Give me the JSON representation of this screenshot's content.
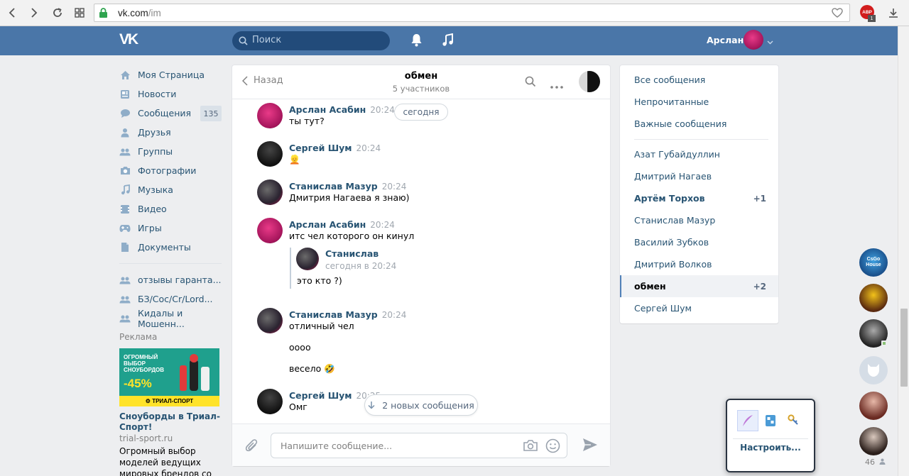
{
  "browser": {
    "url_host": "vk.com",
    "url_path": "/im",
    "abp": "ABP",
    "abp_badge": "1"
  },
  "header": {
    "logo": "VK",
    "search_placeholder": "Поиск",
    "user_name": "Арслан"
  },
  "left_menu": {
    "items": [
      {
        "label": "Моя Страница",
        "icon": "home-icon"
      },
      {
        "label": "Новости",
        "icon": "news-icon"
      },
      {
        "label": "Сообщения",
        "icon": "messages-icon",
        "count": "135"
      },
      {
        "label": "Друзья",
        "icon": "friend-icon"
      },
      {
        "label": "Группы",
        "icon": "groups-icon"
      },
      {
        "label": "Фотографии",
        "icon": "camera-icon"
      },
      {
        "label": "Музыка",
        "icon": "music-icon"
      },
      {
        "label": "Видео",
        "icon": "video-icon"
      },
      {
        "label": "Игры",
        "icon": "gamepad-icon"
      },
      {
        "label": "Документы",
        "icon": "document-icon"
      }
    ],
    "groups": [
      {
        "label": "отзывы гаранта..."
      },
      {
        "label": "БЗ/Coc/Cr/Lord..."
      },
      {
        "label": "Кидалы и Мошенн..."
      }
    ],
    "ad": {
      "heading": "Реклама",
      "banner_line1": "ОГРОМНЫЙ",
      "banner_line2": "ВЫБОР",
      "banner_line3": "СНОУБОРДОВ",
      "banner_discount": "-45%",
      "banner_brand": "ТРИАЛ-СПОРТ",
      "title": "Сноуборды в Триал-Спорт!",
      "domain": "trial-sport.ru",
      "description": "Огромный выбор моделей ведущих мировых брендов со"
    }
  },
  "chat": {
    "back_label": "Назад",
    "title": "обмен",
    "subtitle": "5 участников",
    "date_divider": "сегодня",
    "messages": [
      {
        "author": "Арслан Асабин",
        "time": "20:24",
        "lines": [
          "ты тут?"
        ]
      },
      {
        "author": "Сергей Шум",
        "time": "20:24",
        "lines": [
          "👱"
        ]
      },
      {
        "author": "Станислав Мазур",
        "time": "20:24",
        "lines": [
          "Дмитрия Нагаева я знаю)"
        ]
      },
      {
        "author": "Арслан Асабин",
        "time": "20:24",
        "lines": [
          "итс чел которого он кинул"
        ]
      },
      {
        "author": "Станислав Мазур",
        "time": "20:24",
        "lines": [
          "отличный чел",
          "оооо",
          "весело 🤣"
        ]
      },
      {
        "author": "Сергей Шум",
        "time": "20:25",
        "lines": [
          "Омг"
        ]
      }
    ],
    "forwarded": {
      "author": "Станислав",
      "time": "сегодня в 20:24",
      "text": "это кто ?)"
    },
    "new_messages": "2 новых сообщения",
    "composer_placeholder": "Напишите сообщение..."
  },
  "right_menu": {
    "filters": [
      "Все сообщения",
      "Непрочитанные",
      "Важные сообщения"
    ],
    "dialogs": [
      {
        "name": "Азат Губайдуллин"
      },
      {
        "name": "Дмитрий Нагаев"
      },
      {
        "name": "Артём Торхов",
        "count": "+1",
        "bold": true
      },
      {
        "name": "Станислав Мазур"
      },
      {
        "name": "Василий Зубков"
      },
      {
        "name": "Дмитрий Волков"
      },
      {
        "name": "обмен",
        "count": "+2",
        "selected": true
      },
      {
        "name": "Сергей Шум"
      }
    ]
  },
  "fast_chat": {
    "avatar_label": "CsGo House",
    "online_count": "46"
  },
  "popup": {
    "configure_label": "Настроить..."
  },
  "colors": {
    "header_bg": "#4a76a8",
    "link": "#285473",
    "page_bg": "#edeef0"
  }
}
